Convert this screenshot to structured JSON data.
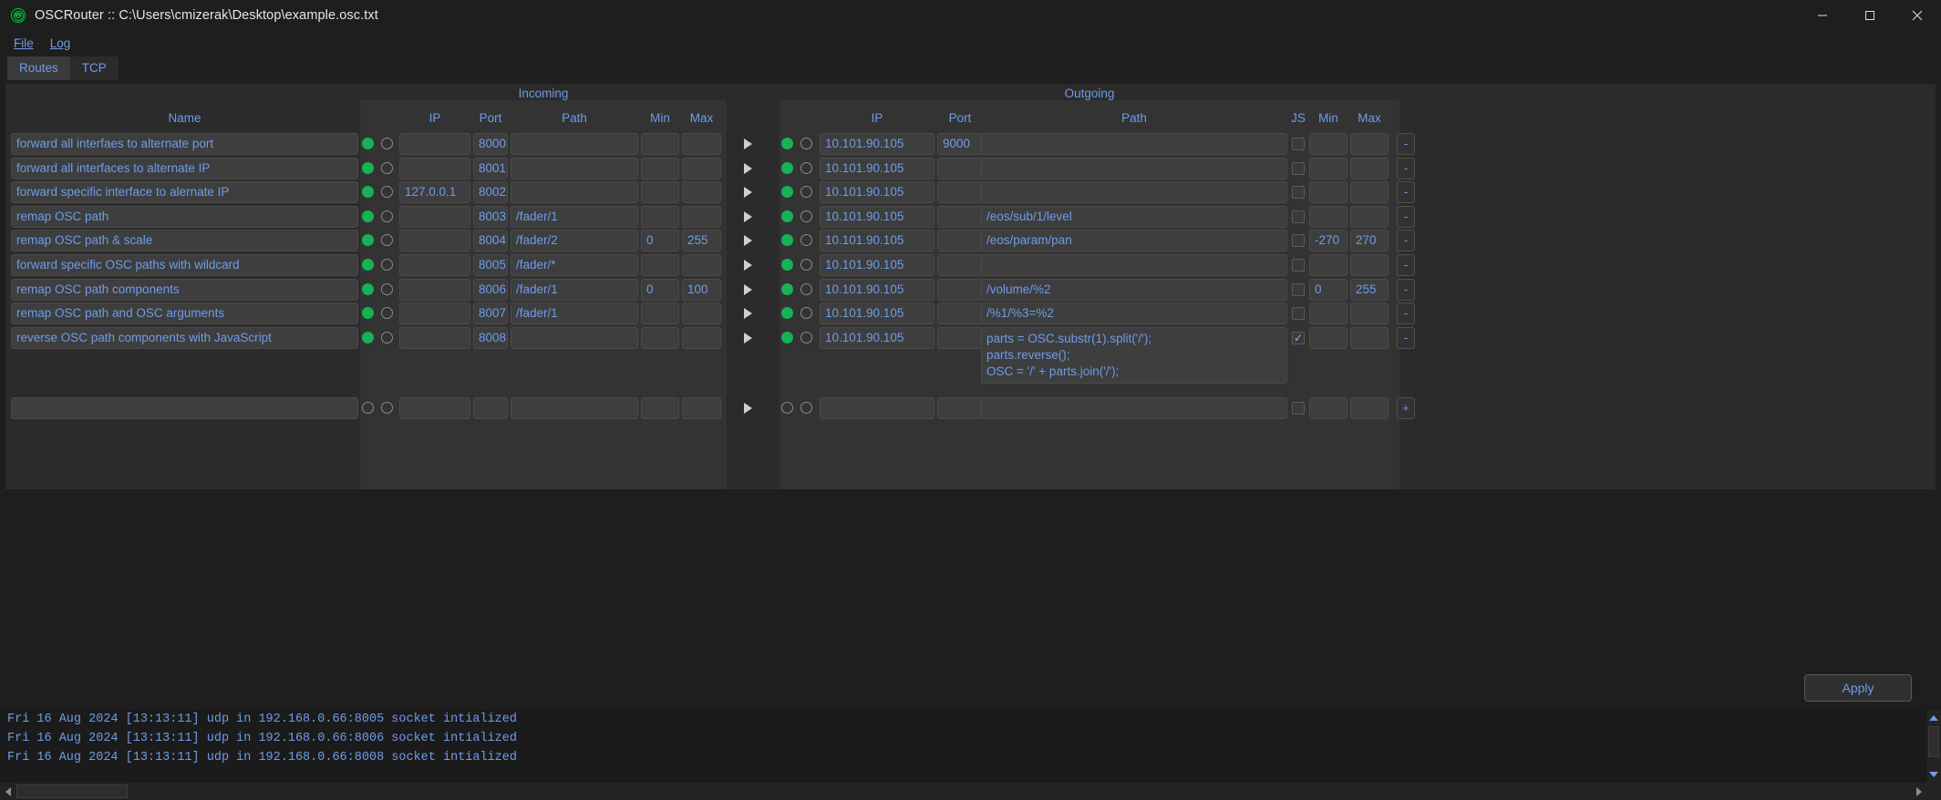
{
  "window": {
    "title": "OSCRouter :: C:\\Users\\cmizerak\\Desktop\\example.osc.txt",
    "icon": "osc-app-icon",
    "minimize": "minimize-icon",
    "maximize": "maximize-icon",
    "close": "close-icon"
  },
  "menu": {
    "items": [
      {
        "label": "File",
        "accel": "F"
      },
      {
        "label": "Log",
        "accel": "L"
      }
    ]
  },
  "tabs": [
    {
      "label": "Routes",
      "active": true
    },
    {
      "label": "TCP",
      "active": false
    }
  ],
  "groups": {
    "incoming": "Incoming",
    "outgoing": "Outgoing"
  },
  "headers": {
    "name": "Name",
    "in_ip": "IP",
    "in_port": "Port",
    "in_path": "Path",
    "in_min": "Min",
    "in_max": "Max",
    "out_ip": "IP",
    "out_port": "Port",
    "out_path": "Path",
    "out_js": "JS",
    "out_min": "Min",
    "out_max": "Max"
  },
  "colors": {
    "accent_text": "#6e9ce8",
    "status_on": "#16b356",
    "panel_bg": "#2b2b2b",
    "section_bg": "#333333",
    "field_bg": "#3e3e3e"
  },
  "buttons": {
    "apply": "Apply",
    "remove": "-",
    "add": "+"
  },
  "rows": [
    {
      "name": "forward all interfaes to alternate port",
      "in_enabled": true,
      "in_active": false,
      "in_ip": "",
      "in_port": "8000",
      "in_path": "",
      "in_min": "",
      "in_max": "",
      "out_enabled": true,
      "out_active": false,
      "out_ip": "10.101.90.105",
      "out_port": "9000",
      "out_path": "",
      "out_js": false,
      "out_min": "",
      "out_max": "",
      "remove": "-"
    },
    {
      "name": "forward all interfaces to alternate IP",
      "in_enabled": true,
      "in_active": false,
      "in_ip": "",
      "in_port": "8001",
      "in_path": "",
      "in_min": "",
      "in_max": "",
      "out_enabled": true,
      "out_active": false,
      "out_ip": "10.101.90.105",
      "out_port": "",
      "out_path": "",
      "out_js": false,
      "out_min": "",
      "out_max": "",
      "remove": "-"
    },
    {
      "name": "forward specific interface to alernate IP",
      "in_enabled": true,
      "in_active": false,
      "in_ip": "127.0.0.1",
      "in_port": "8002",
      "in_path": "",
      "in_min": "",
      "in_max": "",
      "out_enabled": true,
      "out_active": false,
      "out_ip": "10.101.90.105",
      "out_port": "",
      "out_path": "",
      "out_js": false,
      "out_min": "",
      "out_max": "",
      "remove": "-"
    },
    {
      "name": "remap OSC path",
      "in_enabled": true,
      "in_active": false,
      "in_ip": "",
      "in_port": "8003",
      "in_path": "/fader/1",
      "in_min": "",
      "in_max": "",
      "out_enabled": true,
      "out_active": false,
      "out_ip": "10.101.90.105",
      "out_port": "",
      "out_path": "/eos/sub/1/level",
      "out_js": false,
      "out_min": "",
      "out_max": "",
      "remove": "-"
    },
    {
      "name": "remap OSC path & scale",
      "in_enabled": true,
      "in_active": false,
      "in_ip": "",
      "in_port": "8004",
      "in_path": "/fader/2",
      "in_min": "0",
      "in_max": "255",
      "out_enabled": true,
      "out_active": false,
      "out_ip": "10.101.90.105",
      "out_port": "",
      "out_path": "/eos/param/pan",
      "out_js": false,
      "out_min": "-270",
      "out_max": "270",
      "remove": "-"
    },
    {
      "name": "forward specific OSC paths with wildcard",
      "in_enabled": true,
      "in_active": false,
      "in_ip": "",
      "in_port": "8005",
      "in_path": "/fader/*",
      "in_min": "",
      "in_max": "",
      "out_enabled": true,
      "out_active": false,
      "out_ip": "10.101.90.105",
      "out_port": "",
      "out_path": "",
      "out_js": false,
      "out_min": "",
      "out_max": "",
      "remove": "-"
    },
    {
      "name": "remap OSC path components",
      "in_enabled": true,
      "in_active": false,
      "in_ip": "",
      "in_port": "8006",
      "in_path": "/fader/1",
      "in_min": "0",
      "in_max": "100",
      "out_enabled": true,
      "out_active": false,
      "out_ip": "10.101.90.105",
      "out_port": "",
      "out_path": "/volume/%2",
      "out_js": false,
      "out_min": "0",
      "out_max": "255",
      "remove": "-"
    },
    {
      "name": "remap OSC path and OSC arguments",
      "in_enabled": true,
      "in_active": false,
      "in_ip": "",
      "in_port": "8007",
      "in_path": "/fader/1",
      "in_min": "",
      "in_max": "",
      "out_enabled": true,
      "out_active": false,
      "out_ip": "10.101.90.105",
      "out_port": "",
      "out_path": "/%1/%3=%2",
      "out_js": false,
      "out_min": "",
      "out_max": "",
      "remove": "-"
    },
    {
      "name": "reverse OSC path components with JavaScript",
      "in_enabled": true,
      "in_active": false,
      "in_ip": "",
      "in_port": "8008",
      "in_path": "",
      "in_min": "",
      "in_max": "",
      "out_enabled": true,
      "out_active": false,
      "out_ip": "10.101.90.105",
      "out_port": "",
      "out_path": "parts = OSC.substr(1).split('/');\nparts.reverse();\nOSC = '/' + parts.join('/');",
      "out_js": true,
      "out_min": "",
      "out_max": "",
      "remove": "-",
      "tall": true
    }
  ],
  "new_row": {
    "name": "",
    "in_enabled": false,
    "in_active": false,
    "in_ip": "",
    "in_port": "",
    "in_path": "",
    "in_min": "",
    "in_max": "",
    "out_enabled": false,
    "out_active": false,
    "out_ip": "",
    "out_port": "",
    "out_path": "",
    "out_js": false,
    "out_min": "",
    "out_max": "",
    "add": "+"
  },
  "log": {
    "lines": [
      "Fri 16 Aug 2024 [13:13:11] udp in 192.168.0.66:8005 socket intialized",
      "Fri 16 Aug 2024 [13:13:11] udp in 192.168.0.66:8006 socket intialized",
      "Fri 16 Aug 2024 [13:13:11] udp in 192.168.0.66:8008 socket intialized"
    ]
  }
}
